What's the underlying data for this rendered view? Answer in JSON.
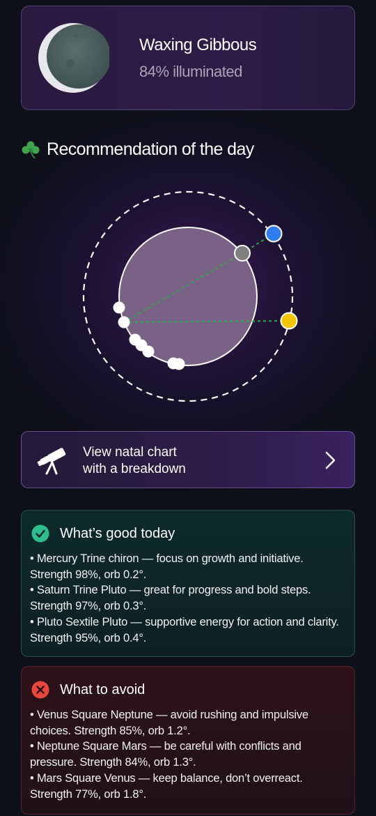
{
  "moon": {
    "phase": "Waxing Gibbous",
    "illumination": "84% illuminated",
    "icon": "moon-phase-icon"
  },
  "recommendation": {
    "title": "Recommendation of the day",
    "icon": "clover-icon"
  },
  "natal_chart_button": {
    "line1": "View natal chart",
    "line2": "with a breakdown",
    "icon": "telescope-icon",
    "chevron": "chevron-right-icon"
  },
  "good": {
    "title": "What’s good today",
    "icon": "check-circle-icon",
    "color": "#2ebd8c",
    "items": [
      "• Mercury Trine chiron — focus on growth and initiative. Strength 98%, orb 0.2°.",
      " • Saturn Trine Pluto — great for progress and bold steps. Strength 97%, orb 0.3°.",
      " • Pluto Sextile Pluto — supportive energy for action and clarity. Strength 95%, orb 0.4°."
    ]
  },
  "avoid": {
    "title": "What to avoid",
    "icon": "x-circle-icon",
    "color": "#e8473c",
    "items": [
      "• Venus Square Neptune — avoid rushing and impulsive choices. Strength 85%, orb 1.2°.",
      " • Neptune Square Mars — be careful with conflicts and pressure. Strength 84%, orb 1.3°.",
      " • Mars Square Venus — keep balance, don’t overreact. Strength 77%, orb 1.8°."
    ]
  },
  "colors": {
    "blue_planet": "#2f7ef0",
    "yellow_planet": "#f5c400",
    "grey_planet": "#808080",
    "aspect_line": "#2aa84a"
  }
}
